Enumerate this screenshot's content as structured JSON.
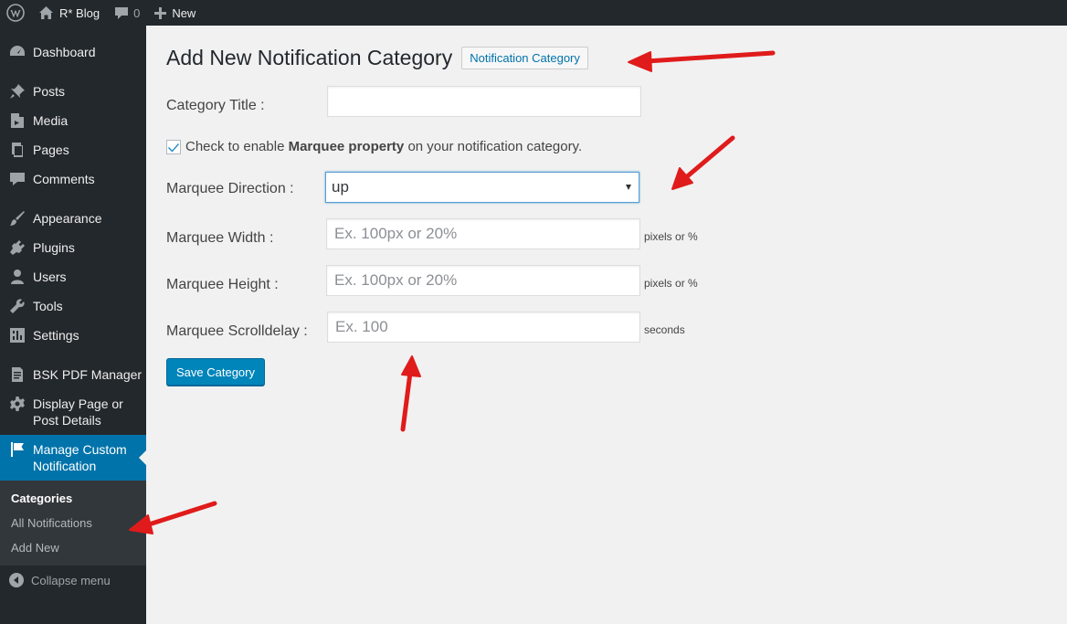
{
  "adminbar": {
    "site_name": "R* Blog",
    "comments_count": "0",
    "new_label": "New"
  },
  "sidebar": {
    "items": [
      {
        "label": "Dashboard",
        "icon": "dashboard-icon"
      },
      {
        "label": "Posts",
        "icon": "pin-icon"
      },
      {
        "label": "Media",
        "icon": "media-icon"
      },
      {
        "label": "Pages",
        "icon": "pages-icon"
      },
      {
        "label": "Comments",
        "icon": "comment-icon"
      },
      {
        "label": "Appearance",
        "icon": "paintbrush-icon"
      },
      {
        "label": "Plugins",
        "icon": "plugin-icon"
      },
      {
        "label": "Users",
        "icon": "user-icon"
      },
      {
        "label": "Tools",
        "icon": "wrench-icon"
      },
      {
        "label": "Settings",
        "icon": "settings-icon"
      },
      {
        "label": "BSK PDF Manager",
        "icon": "document-icon"
      },
      {
        "label": "Display Page or Post Details",
        "icon": "gear-icon"
      },
      {
        "label": "Manage Custom Notification",
        "icon": "flag-icon"
      }
    ],
    "submenu": [
      "Categories",
      "All Notifications",
      "Add New"
    ],
    "collapse_label": "Collapse menu"
  },
  "page": {
    "title": "Add New Notification Category",
    "title_action": "Notification Category",
    "category_title_label": "Category Title :",
    "category_title_value": "",
    "checkbox_pre": "Check to enable ",
    "checkbox_bold": "Marquee property",
    "checkbox_post": " on your notification category.",
    "checkbox_checked": true,
    "direction_label": "Marquee Direction :",
    "direction_value": "up",
    "width_label": "Marquee Width :",
    "width_placeholder": "Ex. 100px or 20%",
    "width_hint": "pixels or %",
    "height_label": "Marquee Height :",
    "height_placeholder": "Ex. 100px or 20%",
    "height_hint": "pixels or %",
    "scrolldelay_label": "Marquee Scrolldelay :",
    "scrolldelay_placeholder": "Ex. 100",
    "scrolldelay_hint": "seconds",
    "save_label": "Save Category"
  },
  "colors": {
    "adminbar_bg": "#23282d",
    "accent": "#0073aa",
    "button": "#0085ba",
    "annotation_arrow": "#e01b1b"
  }
}
